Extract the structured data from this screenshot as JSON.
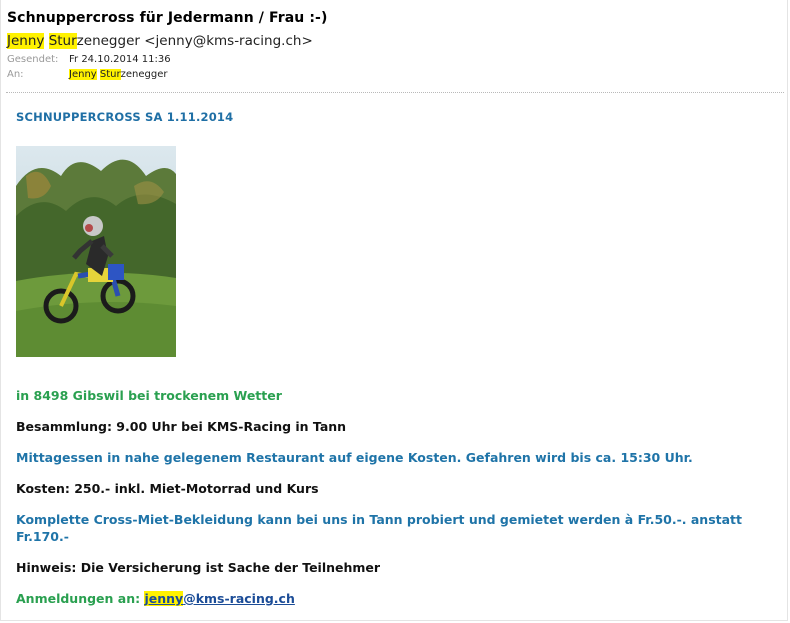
{
  "header": {
    "subject": "Schnuppercross für Jedermann / Frau  :-)",
    "sender_name_hl1": "Jenny",
    "sender_name_hl2": "Stur",
    "sender_name_rest": "zenegger",
    "sender_email": "<jenny@kms-racing.ch>",
    "sent_label": "Gesendet:",
    "sent_value": "Fr 24.10.2014 11:36",
    "to_label": "An:",
    "to_hl1": "Jenny",
    "to_hl2": "Stur",
    "to_rest": "zenegger"
  },
  "body": {
    "title": "SCHNUPPERCROSS  SA  1.11.2014",
    "location": "in 8498 Gibswil bei trockenem Wetter",
    "meeting": "Besammlung: 9.00 Uhr bei KMS-Racing in Tann",
    "lunch": "Mittagessen in nahe gelegenem Restaurant auf eigene Kosten. Gefahren wird bis ca. 15:30 Uhr.",
    "costs": "Kosten:  250.- inkl. Miet-Motorrad und Kurs",
    "clothing": "Komplette Cross-Miet-Bekleidung kann bei uns in Tann probiert und gemietet werden à Fr.50.-. anstatt Fr.170.-",
    "note": "Hinweis: Die Versicherung ist Sache der Teilnehmer",
    "register_label": "Anmeldungen an:",
    "register_email_hl": "jenny",
    "register_email_rest": "@kms-racing.ch"
  },
  "colors": {
    "highlight": "#fff200",
    "blue_text": "#1f74a8",
    "green_text": "#2aa050",
    "link": "#1b4c97"
  }
}
